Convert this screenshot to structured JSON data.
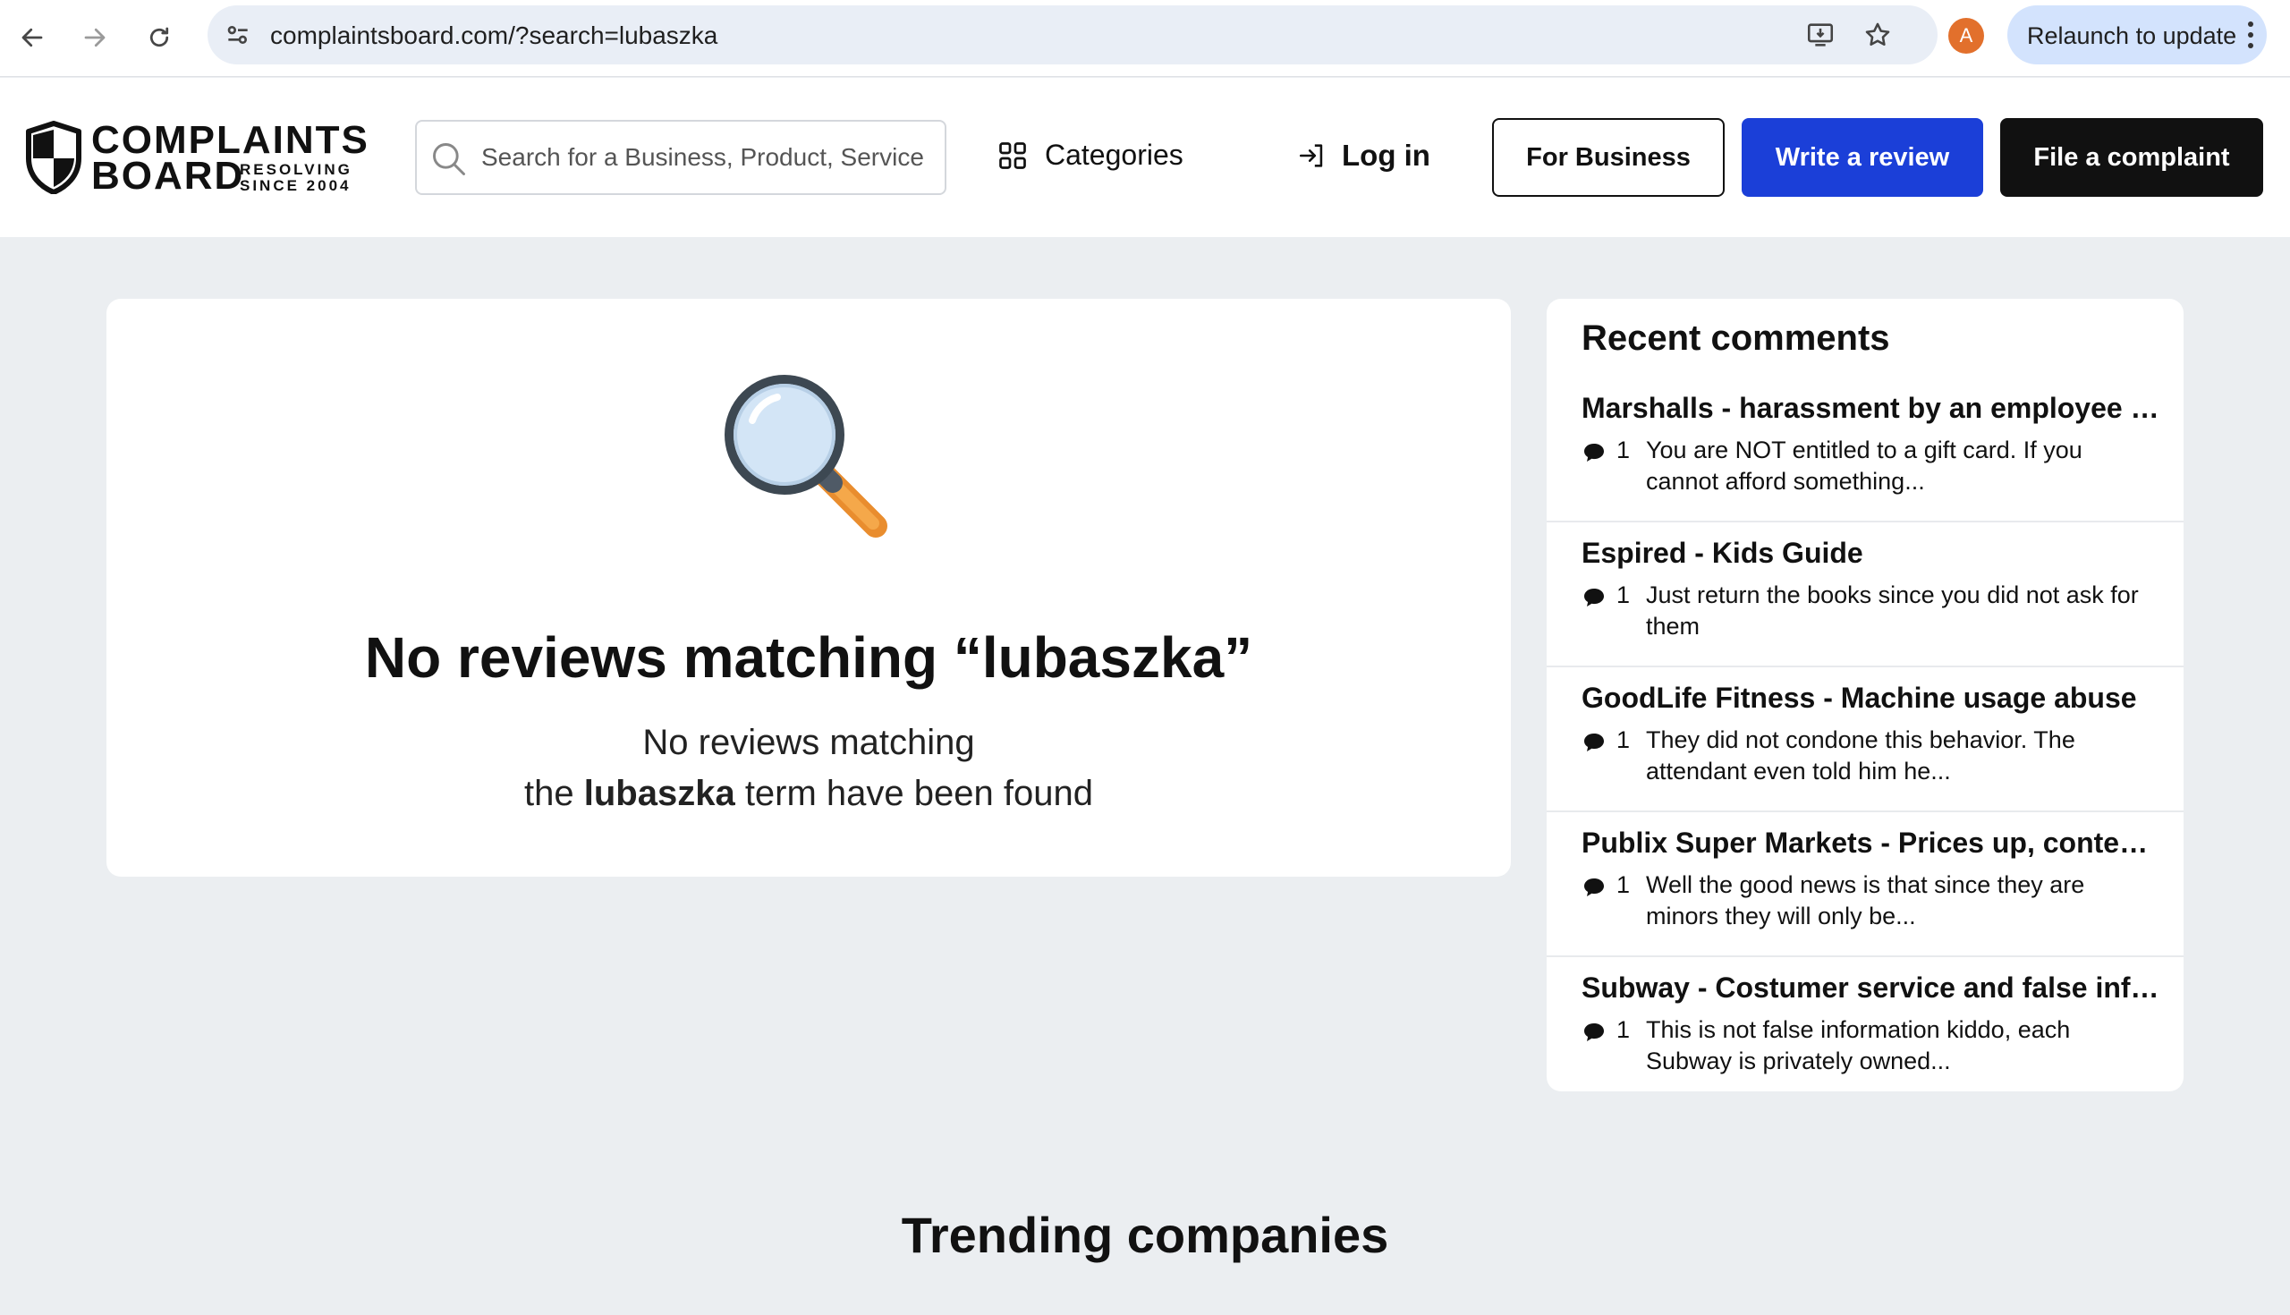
{
  "browser": {
    "url": "complaintsboard.com/?search=lubaszka",
    "profile_initial": "A",
    "relaunch_label": "Relaunch to update"
  },
  "header": {
    "logo": {
      "line1": "COMPLAINTS",
      "line2": "BOARD",
      "tagline_1": "RESOLVING",
      "tagline_2": "SINCE 2004"
    },
    "search_placeholder": "Search for a Business, Product, Service",
    "categories_label": "Categories",
    "login_label": "Log in",
    "for_business_label": "For Business",
    "write_review_label": "Write a review",
    "file_complaint_label": "File a complaint"
  },
  "results": {
    "title": "No reviews matching “lubaszka”",
    "sub_line1": "No reviews matching",
    "sub_pre": "the ",
    "sub_term": "lubaszka",
    "sub_post": " term have been found"
  },
  "recent_comments": {
    "title": "Recent comments",
    "items": [
      {
        "title": "Marshalls - harassment by an employee and supervisor",
        "count": "1",
        "text": "You are NOT entitled to a gift card. If you cannot afford something..."
      },
      {
        "title": "Espired - Kids Guide",
        "count": "1",
        "text": "Just return the books since you did not ask for them"
      },
      {
        "title": "GoodLife Fitness - Machine usage abuse",
        "count": "1",
        "text": "They did not condone this behavior. The attendant even told him he..."
      },
      {
        "title": "Publix Super Markets - Prices up, content down",
        "count": "1",
        "text": "Well the good news is that since they are minors they will only be..."
      },
      {
        "title": "Subway - Costumer service and false information",
        "count": "1",
        "text": "This is not false information kiddo, each Subway is privately owned..."
      }
    ]
  },
  "trending_title": "Trending companies",
  "colors": {
    "accent_blue": "#1b3fd8",
    "dark": "#111111",
    "page_bg": "#ebeef1",
    "avatar": "#e2702c",
    "relaunch_bg": "#d3e3fd"
  }
}
